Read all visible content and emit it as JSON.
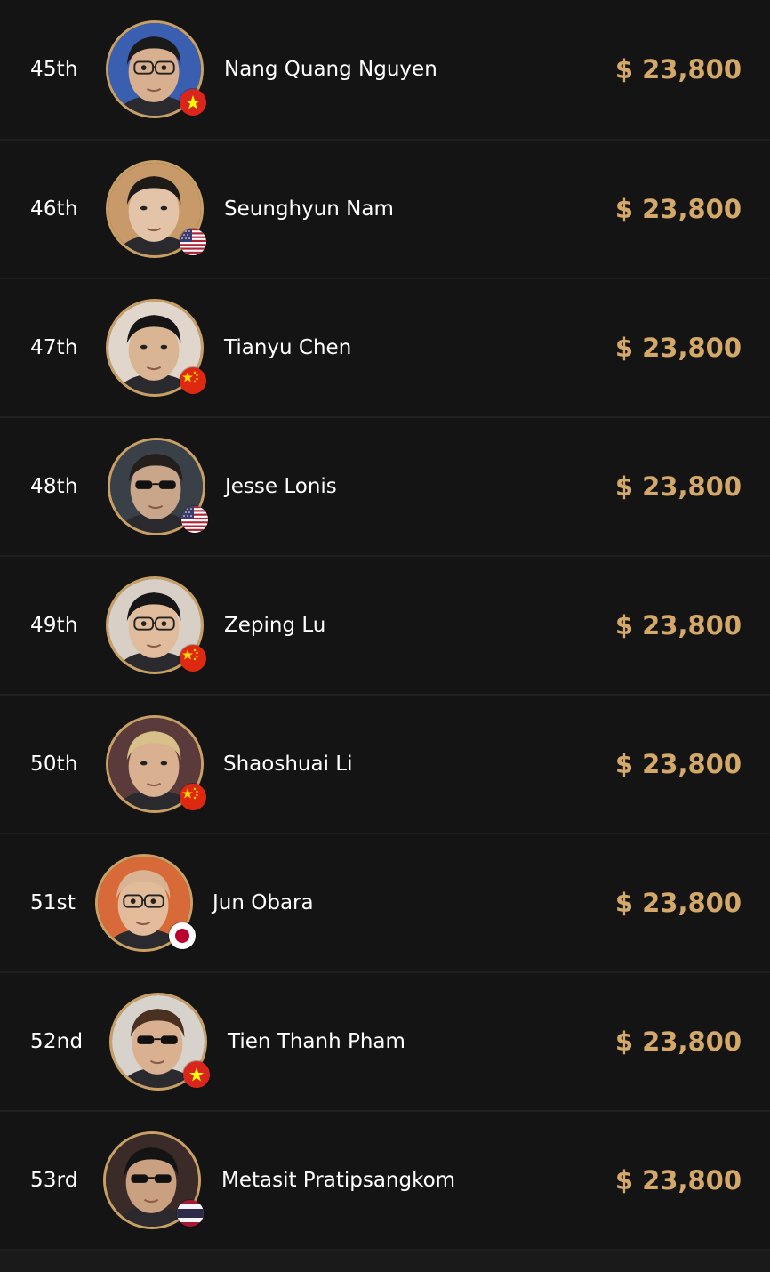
{
  "players": [
    {
      "rank": "45th",
      "name": "Nang Quang Nguyen",
      "prize": "$ 23,800",
      "flag": "vietnam-flag-icon",
      "avatar_bg": "#3a5fb0",
      "hair": "#1a1a1a",
      "skin": "#d8b090",
      "glasses": true,
      "shades": false
    },
    {
      "rank": "46th",
      "name": "Seunghyun Nam",
      "prize": "$ 23,800",
      "flag": "usa-flag-icon",
      "avatar_bg": "#c89a6a",
      "hair": "#1e1a18",
      "skin": "#e3c4a8",
      "glasses": false,
      "shades": false
    },
    {
      "rank": "47th",
      "name": "Tianyu Chen",
      "prize": "$ 23,800",
      "flag": "china-flag-icon",
      "avatar_bg": "#e0d6cc",
      "hair": "#151515",
      "skin": "#d9b594",
      "glasses": false,
      "shades": false
    },
    {
      "rank": "48th",
      "name": "Jesse Lonis",
      "prize": "$ 23,800",
      "flag": "usa-flag-icon",
      "avatar_bg": "#3a4048",
      "hair": "#241f1c",
      "skin": "#c9a58a",
      "glasses": false,
      "shades": true
    },
    {
      "rank": "49th",
      "name": "Zeping Lu",
      "prize": "$ 23,800",
      "flag": "china-flag-icon",
      "avatar_bg": "#d8cfc6",
      "hair": "#161616",
      "skin": "#e0bc9c",
      "glasses": true,
      "shades": false
    },
    {
      "rank": "50th",
      "name": "Shaoshuai Li",
      "prize": "$ 23,800",
      "flag": "china-flag-icon",
      "avatar_bg": "#5a3a3a",
      "hair": "#d8c08a",
      "skin": "#d9b090",
      "glasses": false,
      "shades": false
    },
    {
      "rank": "51st",
      "name": "Jun Obara",
      "prize": "$ 23,800",
      "flag": "japan-flag-icon",
      "avatar_bg": "#d86a3a",
      "hair": "#d9b494",
      "skin": "#e2bc9a",
      "glasses": true,
      "shades": false
    },
    {
      "rank": "52nd",
      "name": "Tien Thanh Pham",
      "prize": "$ 23,800",
      "flag": "vietnam-flag-icon",
      "avatar_bg": "#d8d2cc",
      "hair": "#4a3020",
      "skin": "#d9b090",
      "glasses": false,
      "shades": true
    },
    {
      "rank": "53rd",
      "name": "Metasit Pratipsangkom",
      "prize": "$ 23,800",
      "flag": "thailand-flag-icon",
      "avatar_bg": "#3a2a28",
      "hair": "#141414",
      "skin": "#c9a080",
      "glasses": false,
      "shades": true
    }
  ],
  "colors": {
    "accent_gold": "#d4a868",
    "row_bg": "#141414",
    "text": "#ffffff"
  }
}
